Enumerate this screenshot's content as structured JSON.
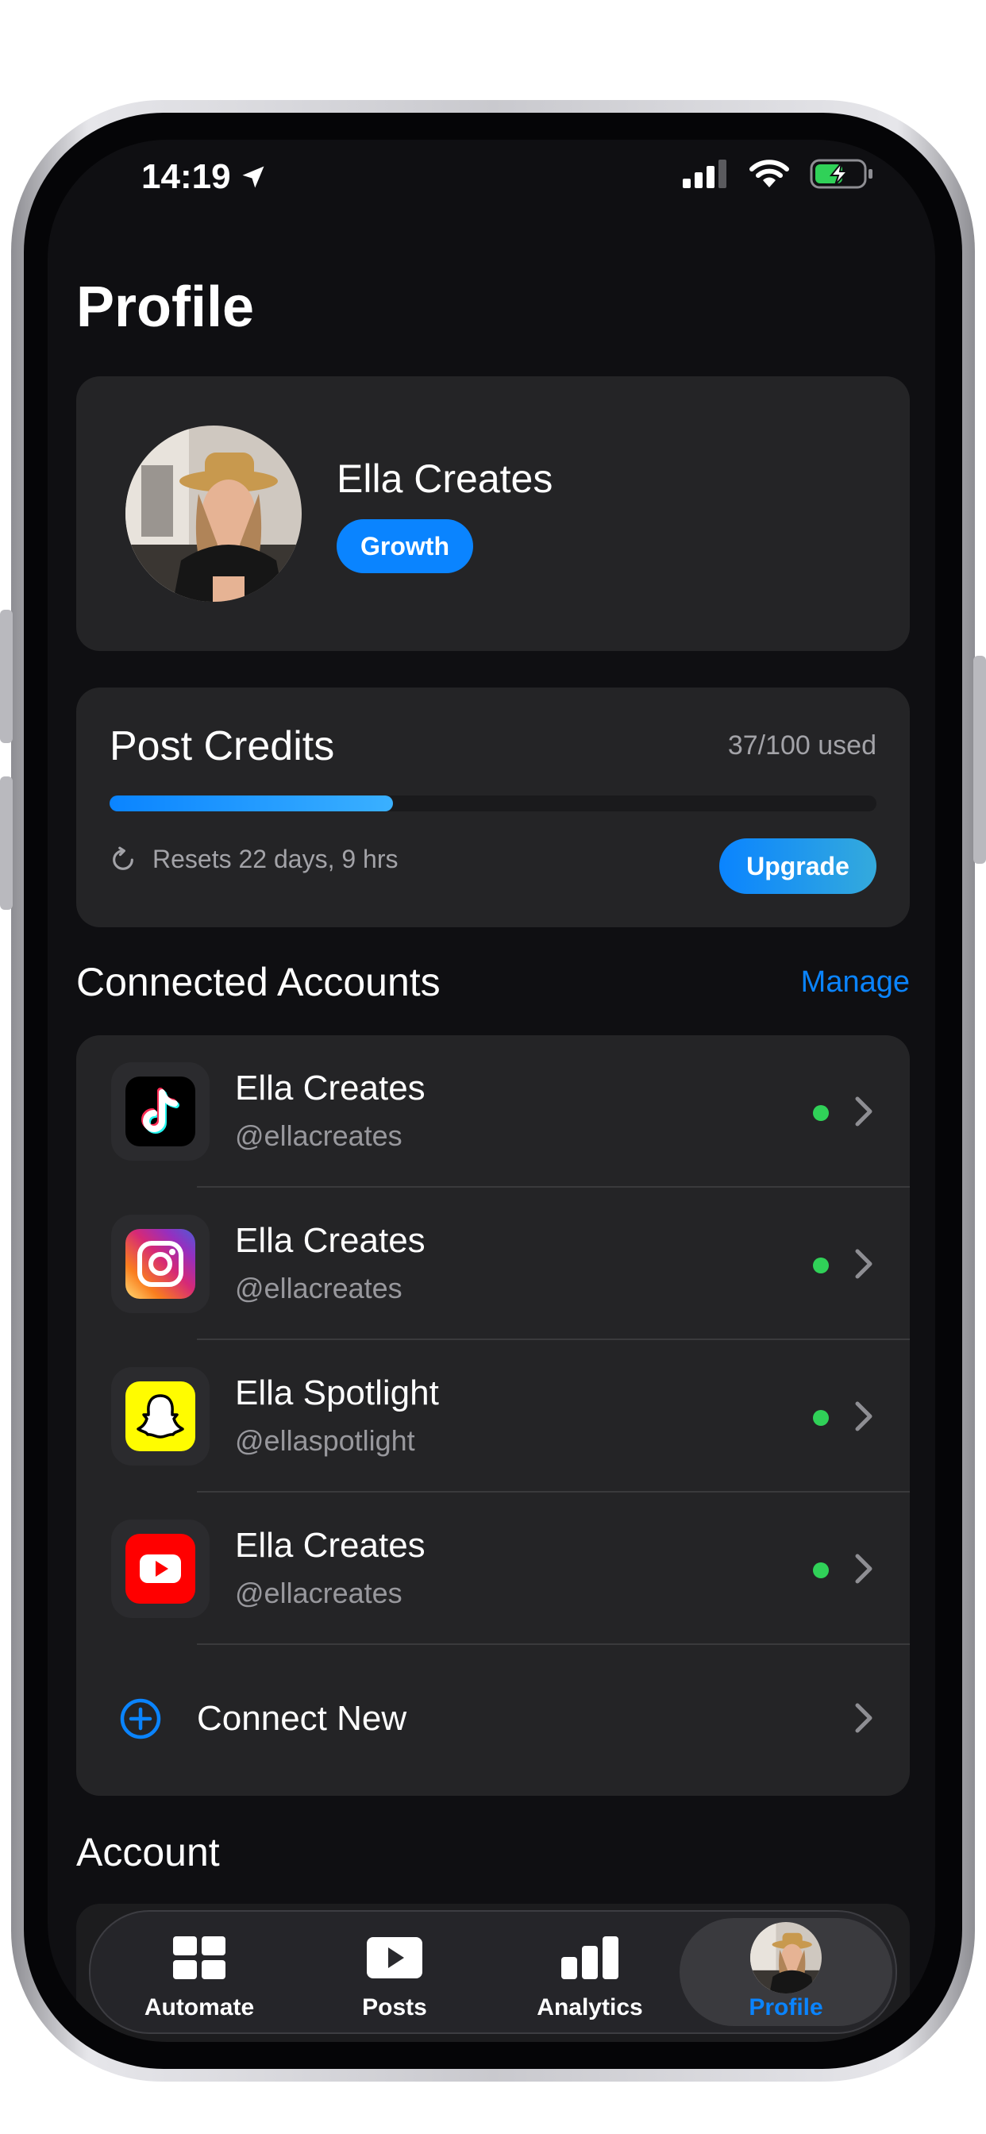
{
  "status_bar": {
    "time": "14:19"
  },
  "page_title": "Profile",
  "profile": {
    "name": "Ella Creates",
    "plan": "Growth"
  },
  "credits": {
    "title": "Post Credits",
    "usage": "37/100 used",
    "used_fraction": 0.37,
    "reset_text": "Resets 22 days, 9 hrs",
    "upgrade_label": "Upgrade"
  },
  "connected": {
    "title": "Connected Accounts",
    "manage_label": "Manage",
    "accounts": [
      {
        "platform": "tiktok",
        "name": "Ella Creates",
        "handle": "@ellacreates"
      },
      {
        "platform": "instagram",
        "name": "Ella Creates",
        "handle": "@ellacreates"
      },
      {
        "platform": "snapchat",
        "name": "Ella Spotlight",
        "handle": "@ellaspotlight"
      },
      {
        "platform": "youtube",
        "name": "Ella Creates",
        "handle": "@ellacreates"
      }
    ],
    "connect_new_label": "Connect New"
  },
  "account_section": {
    "title": "Account"
  },
  "tabbar": {
    "tabs": [
      {
        "label": "Automate",
        "icon": "grid-icon"
      },
      {
        "label": "Posts",
        "icon": "play-icon"
      },
      {
        "label": "Analytics",
        "icon": "bar-chart-icon"
      },
      {
        "label": "Profile",
        "icon": "avatar",
        "active": true
      }
    ]
  },
  "colors": {
    "accent": "#0a84ff",
    "online": "#30d158",
    "card": "#242426",
    "background": "#0f0f12"
  }
}
